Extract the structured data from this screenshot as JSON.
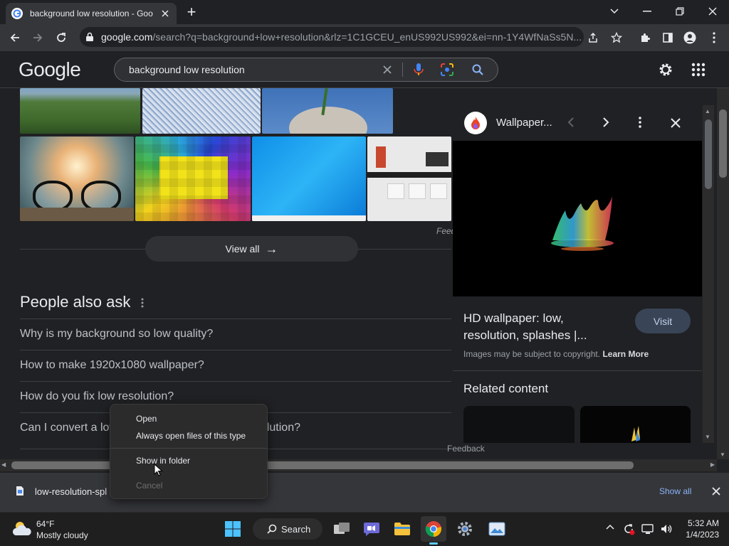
{
  "browser": {
    "tab_title": "background low resolution - Goo",
    "new_tab_symbol": "+",
    "url_host": "google.com",
    "url_path": "/search?q=background+low+resolution&rlz=1C1GCEU_enUS992US992&ei=nn-1Y4WfNaSs5N..."
  },
  "google": {
    "logo": "Google",
    "search_query": "background low resolution"
  },
  "images": {
    "feedback_partial": "Feed",
    "view_all_label": "View all",
    "view_all_arrow": "→"
  },
  "people_also_ask": {
    "heading": "People also ask",
    "questions": [
      "Why is my background so low quality?",
      "How to make 1920x1080 wallpaper?",
      "How do you fix low resolution?",
      "Can I convert a low resolution image to high resolution?"
    ]
  },
  "side_panel": {
    "source_name": "Wallpaper...",
    "title_line1": "HD wallpaper: low,",
    "title_line2": "resolution, splashes |...",
    "visit_label": "Visit",
    "copyright_text": "Images may be subject to copyright.",
    "learn_more": "Learn More",
    "related_heading": "Related content",
    "feedback": "Feedback"
  },
  "context_menu": {
    "items": [
      "Open",
      "Always open files of this type",
      "Show in folder",
      "Cancel"
    ]
  },
  "download_bar": {
    "filename": "low-resolution-spl",
    "show_all": "Show all"
  },
  "taskbar": {
    "temperature": "64°F",
    "weather": "Mostly cloudy",
    "search_label": "Search",
    "time": "5:32 AM",
    "date": "1/4/2023"
  },
  "colors": {
    "accent_blue": "#8ab4f8",
    "panel_bg": "#202124",
    "toolbar_bg": "#35363a"
  }
}
